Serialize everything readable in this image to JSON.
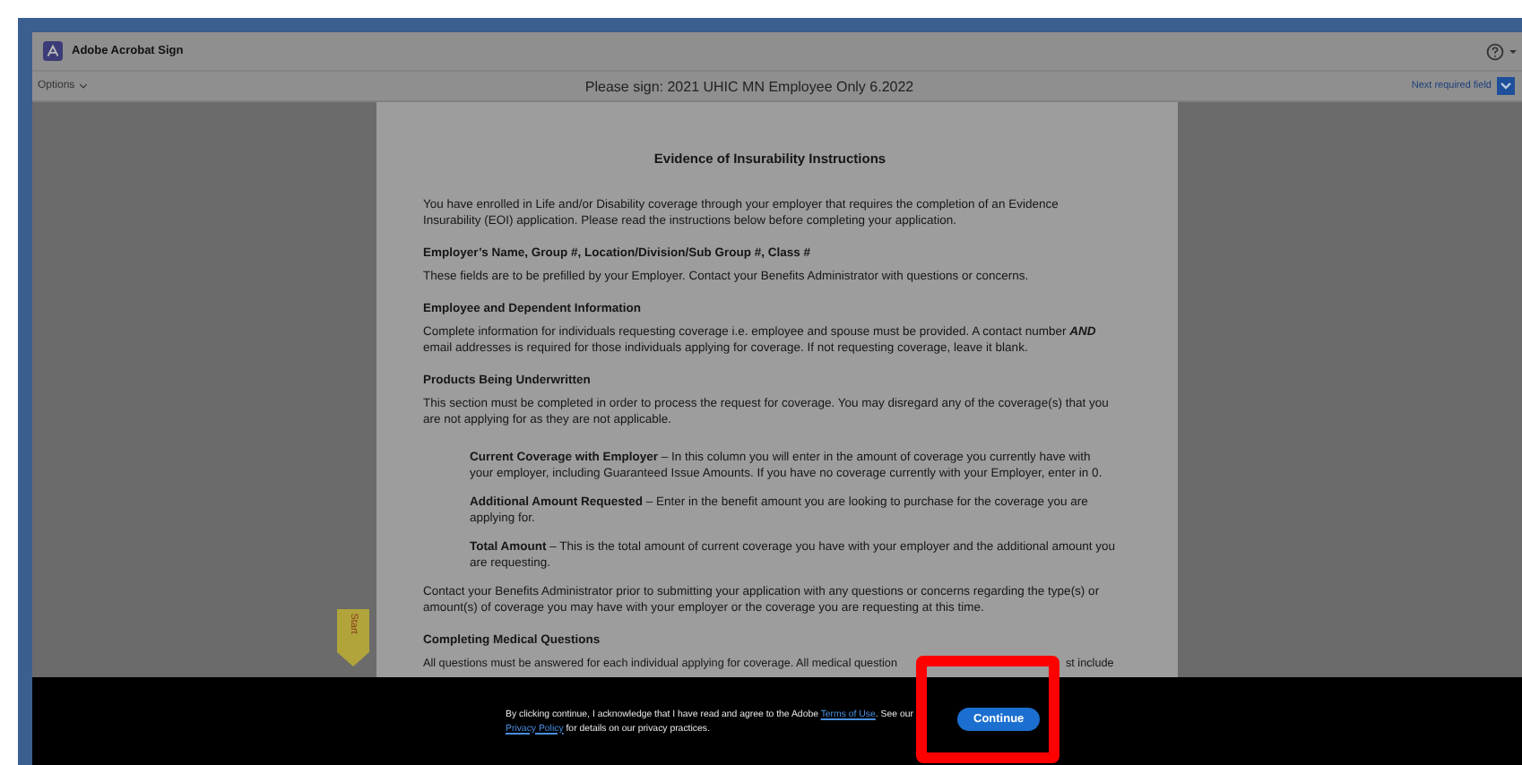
{
  "app": {
    "name": "Adobe Acrobat Sign"
  },
  "toolbar": {
    "options_label": "Options",
    "document_title": "Please sign: 2021 UHIC MN Employee Only 6.2022",
    "next_field_label": "Next required field"
  },
  "start_tag": {
    "label": "Start"
  },
  "document": {
    "title": "Evidence of Insurability Instructions",
    "blocks": [
      {
        "kind": "paragraph",
        "text": "You have enrolled in Life and/or Disability coverage through your employer that requires the completion of an Evidence Insurability (EOI) application. Please read the instructions below before completing your application."
      },
      {
        "kind": "heading",
        "text": "Employer’s Name, Group #, Location/Division/Sub Group #, Class #"
      },
      {
        "kind": "paragraph",
        "text": "These fields are to be prefilled by your Employer. Contact your Benefits Administrator with questions or concerns."
      },
      {
        "kind": "heading",
        "text": "Employee and Dependent Information"
      },
      {
        "kind": "paragraph",
        "text": "Complete information for individuals requesting coverage i.e. employee and spouse must be provided. A contact number **AND** email addresses is required for those individuals applying for coverage. If not requesting coverage, leave it blank."
      },
      {
        "kind": "heading",
        "text": "Products Being Underwritten"
      },
      {
        "kind": "paragraph",
        "text": "This section must be completed in order to process the request for coverage. You may disregard any of the coverage(s) that you are not applying for as they are not applicable."
      },
      {
        "kind": "item",
        "text": "**Current Coverage with Employer** – In this column you will enter in the amount of coverage you currently have with your employer, including Guaranteed Issue Amounts. If you have no coverage currently with your Employer, enter in 0."
      },
      {
        "kind": "item",
        "text": "**Additional Amount Requested** – Enter in the benefit amount you are looking to purchase for the coverage you are applying for."
      },
      {
        "kind": "item",
        "text": "**Total Amount** – This is the total amount of current coverage you have with your employer and the additional amount you are requesting."
      },
      {
        "kind": "paragraph",
        "text": "Contact your Benefits Administrator prior to submitting your application with any questions or concerns regarding the type(s) or amount(s) of coverage you may have with your employer or the coverage you are requesting at this time."
      },
      {
        "kind": "heading",
        "text": "Completing Medical Questions"
      },
      {
        "kind": "partial",
        "parts": [
          "All questions must be answered for each individual applying for coverage. All medical question",
          "st include"
        ]
      }
    ]
  },
  "consent": {
    "parts": [
      {
        "kind": "text",
        "text": "By clicking continue, I acknowledge that I have read and agree to the Adobe "
      },
      {
        "kind": "link",
        "text": "Terms of Use"
      },
      {
        "kind": "text",
        "text": ". See our "
      },
      {
        "kind": "link",
        "text": "Privacy Policy"
      },
      {
        "kind": "text",
        "text": " for details on our privacy practices."
      }
    ],
    "button": "Continue"
  }
}
